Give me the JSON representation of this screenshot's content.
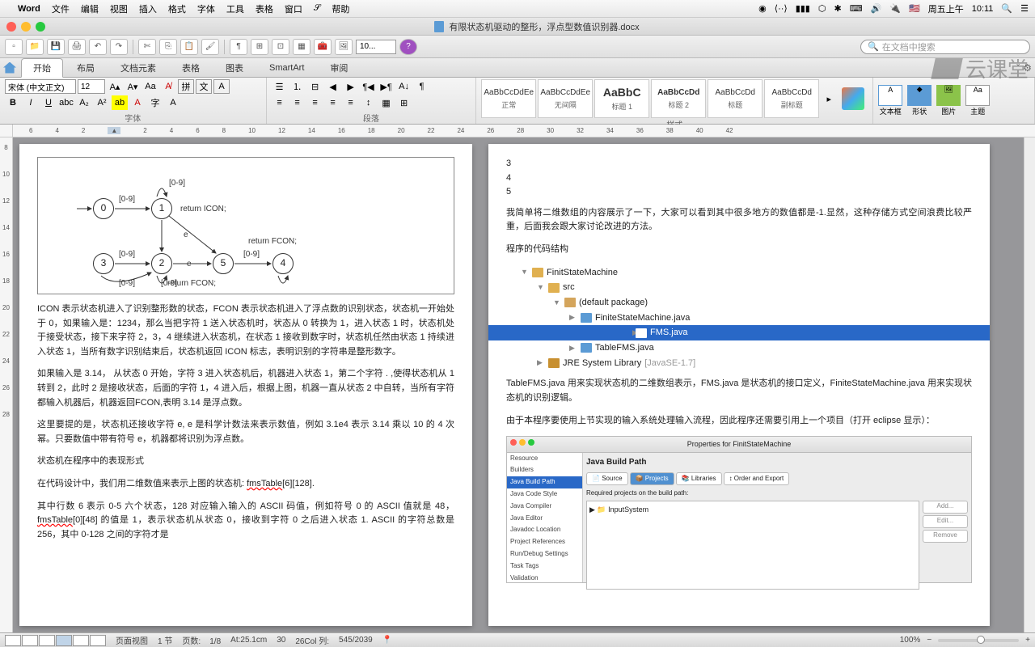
{
  "menubar": {
    "app": "Word",
    "items": [
      "文件",
      "编辑",
      "视图",
      "插入",
      "格式",
      "字体",
      "工具",
      "表格",
      "窗口"
    ],
    "scripts": "帮助",
    "right": {
      "day": "周五上午",
      "time": "10:11"
    }
  },
  "window": {
    "title": "有限状态机驱动的整形，浮点型数值识别器.docx"
  },
  "toolbar": {
    "zoom": "10...",
    "search_placeholder": "在文档中搜索"
  },
  "ribbon": {
    "tabs": [
      "开始",
      "布局",
      "文档元素",
      "表格",
      "图表",
      "SmartArt",
      "审阅"
    ],
    "groups": {
      "font": "字体",
      "paragraph": "段落",
      "styles": "样式",
      "theme": "主题"
    },
    "font_name": "宋体 (中文正文)",
    "font_size": "12",
    "style_items": [
      {
        "preview": "AaBbCcDdEe",
        "name": "正常"
      },
      {
        "preview": "AaBbCcDdEe",
        "name": "无间隔"
      },
      {
        "preview": "AaBbC",
        "name": "标题 1"
      },
      {
        "preview": "AaBbCcDd",
        "name": "标题 2"
      },
      {
        "preview": "AaBbCcDd",
        "name": "标题"
      },
      {
        "preview": "AaBbCcDd",
        "name": "副标题"
      }
    ],
    "insert": {
      "textbox": "文本框",
      "shape": "形状",
      "picture": "图片",
      "theme": "主题"
    }
  },
  "page1": {
    "diagram": {
      "states": [
        "0",
        "1",
        "2",
        "3",
        "4",
        "5"
      ],
      "labels": {
        "icon": "return ICON;",
        "fcon": "return FCON;",
        "fcon2": "return FCON;",
        "d": "[0-9]",
        "e": "e"
      }
    },
    "p1": "ICON 表示状态机进入了识别整形数的状态，FCON 表示状态机进入了浮点数的识别状态，状态机一开始处于 0，如果输入是：1234，那么当把字符 1 送入状态机时，状态从 0 转换为 1，进入状态 1 时，状态机处于接受状态，接下来字符 2，3，4 继续进入状态机，在状态 1 接收到数字时，状态机任然由状态 1 持续进入状态 1，当所有数字识别结束后，状态机返回 ICON 标志，表明识别的字符串是整形数字。",
    "p2": "如果输入是 3.14，  从状态 0 开始，字符 3 进入状态机后，机器进入状态 1，第二个字符 . ,使得状态机从 1 转到 2，此时 2 是接收状态，后面的字符 1，4 进入后，根据上图，机器一直从状态 2 中自转，当所有字符都输入机器后，机器返回FCON,表明 3.14 是浮点数。",
    "p3": "这里要提的是，状态机还接收字符 e, e 是科学计数法来表示数值，例如 3.1e4 表示 3.14 乘以 10 的 4 次幂。只要数值中带有符号 e，机器都将识别为浮点数。",
    "p4": "状态机在程序中的表现形式",
    "p5a": "在代码设计中，我们用二维数值来表示上图的状态机: ",
    "p5b": "fmsTable",
    "p5c": "[6][128].",
    "p6a": "其中行数 6 表示 0-5 六个状态，128 对应输入输入的 ASCII 码值，例如符号 0 的 ASCII 值就是 48， ",
    "p6b": "fmsTable",
    "p6c": "[0][48] 的值是 1，表示状态机从状态 0，接收到字符 0 之后进入状态 1. ASCII 的字符总数是 256，其中 0-128 之间的字符才是"
  },
  "page2": {
    "nums": [
      "3",
      "4",
      "5"
    ],
    "p1": "我简单将二维数组的内容展示了一下，大家可以看到其中很多地方的数值都是-1.显然，这种存储方式空间浪费比较严重，后面我会跟大家讨论改进的方法。",
    "p2": "程序的代码结构",
    "tree": {
      "root": "FinitStateMachine",
      "src": "src",
      "pkg": "(default package)",
      "files": [
        "FiniteStateMachine.java",
        "FMS.java",
        "TableFMS.java"
      ],
      "jre": "JRE System Library",
      "jre_ver": "[JavaSE-1.7]"
    },
    "p3": "TableFMS.java 用来实现状态机的二维数组表示，FMS.java 是状态机的接口定义，FiniteStateMachine.java 用来实现状态机的识别逻辑。",
    "p4": "由于本程序要使用上节实现的输入系统处理输入流程，因此程序还需要引用上一个项目（打开 eclipse 显示）：",
    "dialog": {
      "title": "Properties for FinitStateMachine",
      "heading": "Java Build Path",
      "side": [
        "Resource",
        "Builders",
        "Java Build Path",
        "Java Code Style",
        "Java Compiler",
        "Java Editor",
        "Javadoc Location",
        "Project References",
        "Run/Debug Settings",
        "Task Tags",
        "Validation"
      ],
      "tabs": [
        "Source",
        "Projects",
        "Libraries",
        "Order and Export"
      ],
      "tab_icons": [
        "📄",
        "📦",
        "📚",
        "↕"
      ],
      "list_label": "Required projects on the build path:",
      "list_item": "InputSystem",
      "buttons": [
        "Add...",
        "Edit...",
        "Remove"
      ]
    }
  },
  "status": {
    "view": "页面视图",
    "section": "1 节",
    "pages_label": "页数:",
    "pages": "1/8",
    "at": "At:25.1cm",
    "line": "30",
    "col_label": "26Col",
    "col": "列:",
    "chars": "545/2039",
    "zoom": "100%"
  },
  "watermark": "云课堂"
}
